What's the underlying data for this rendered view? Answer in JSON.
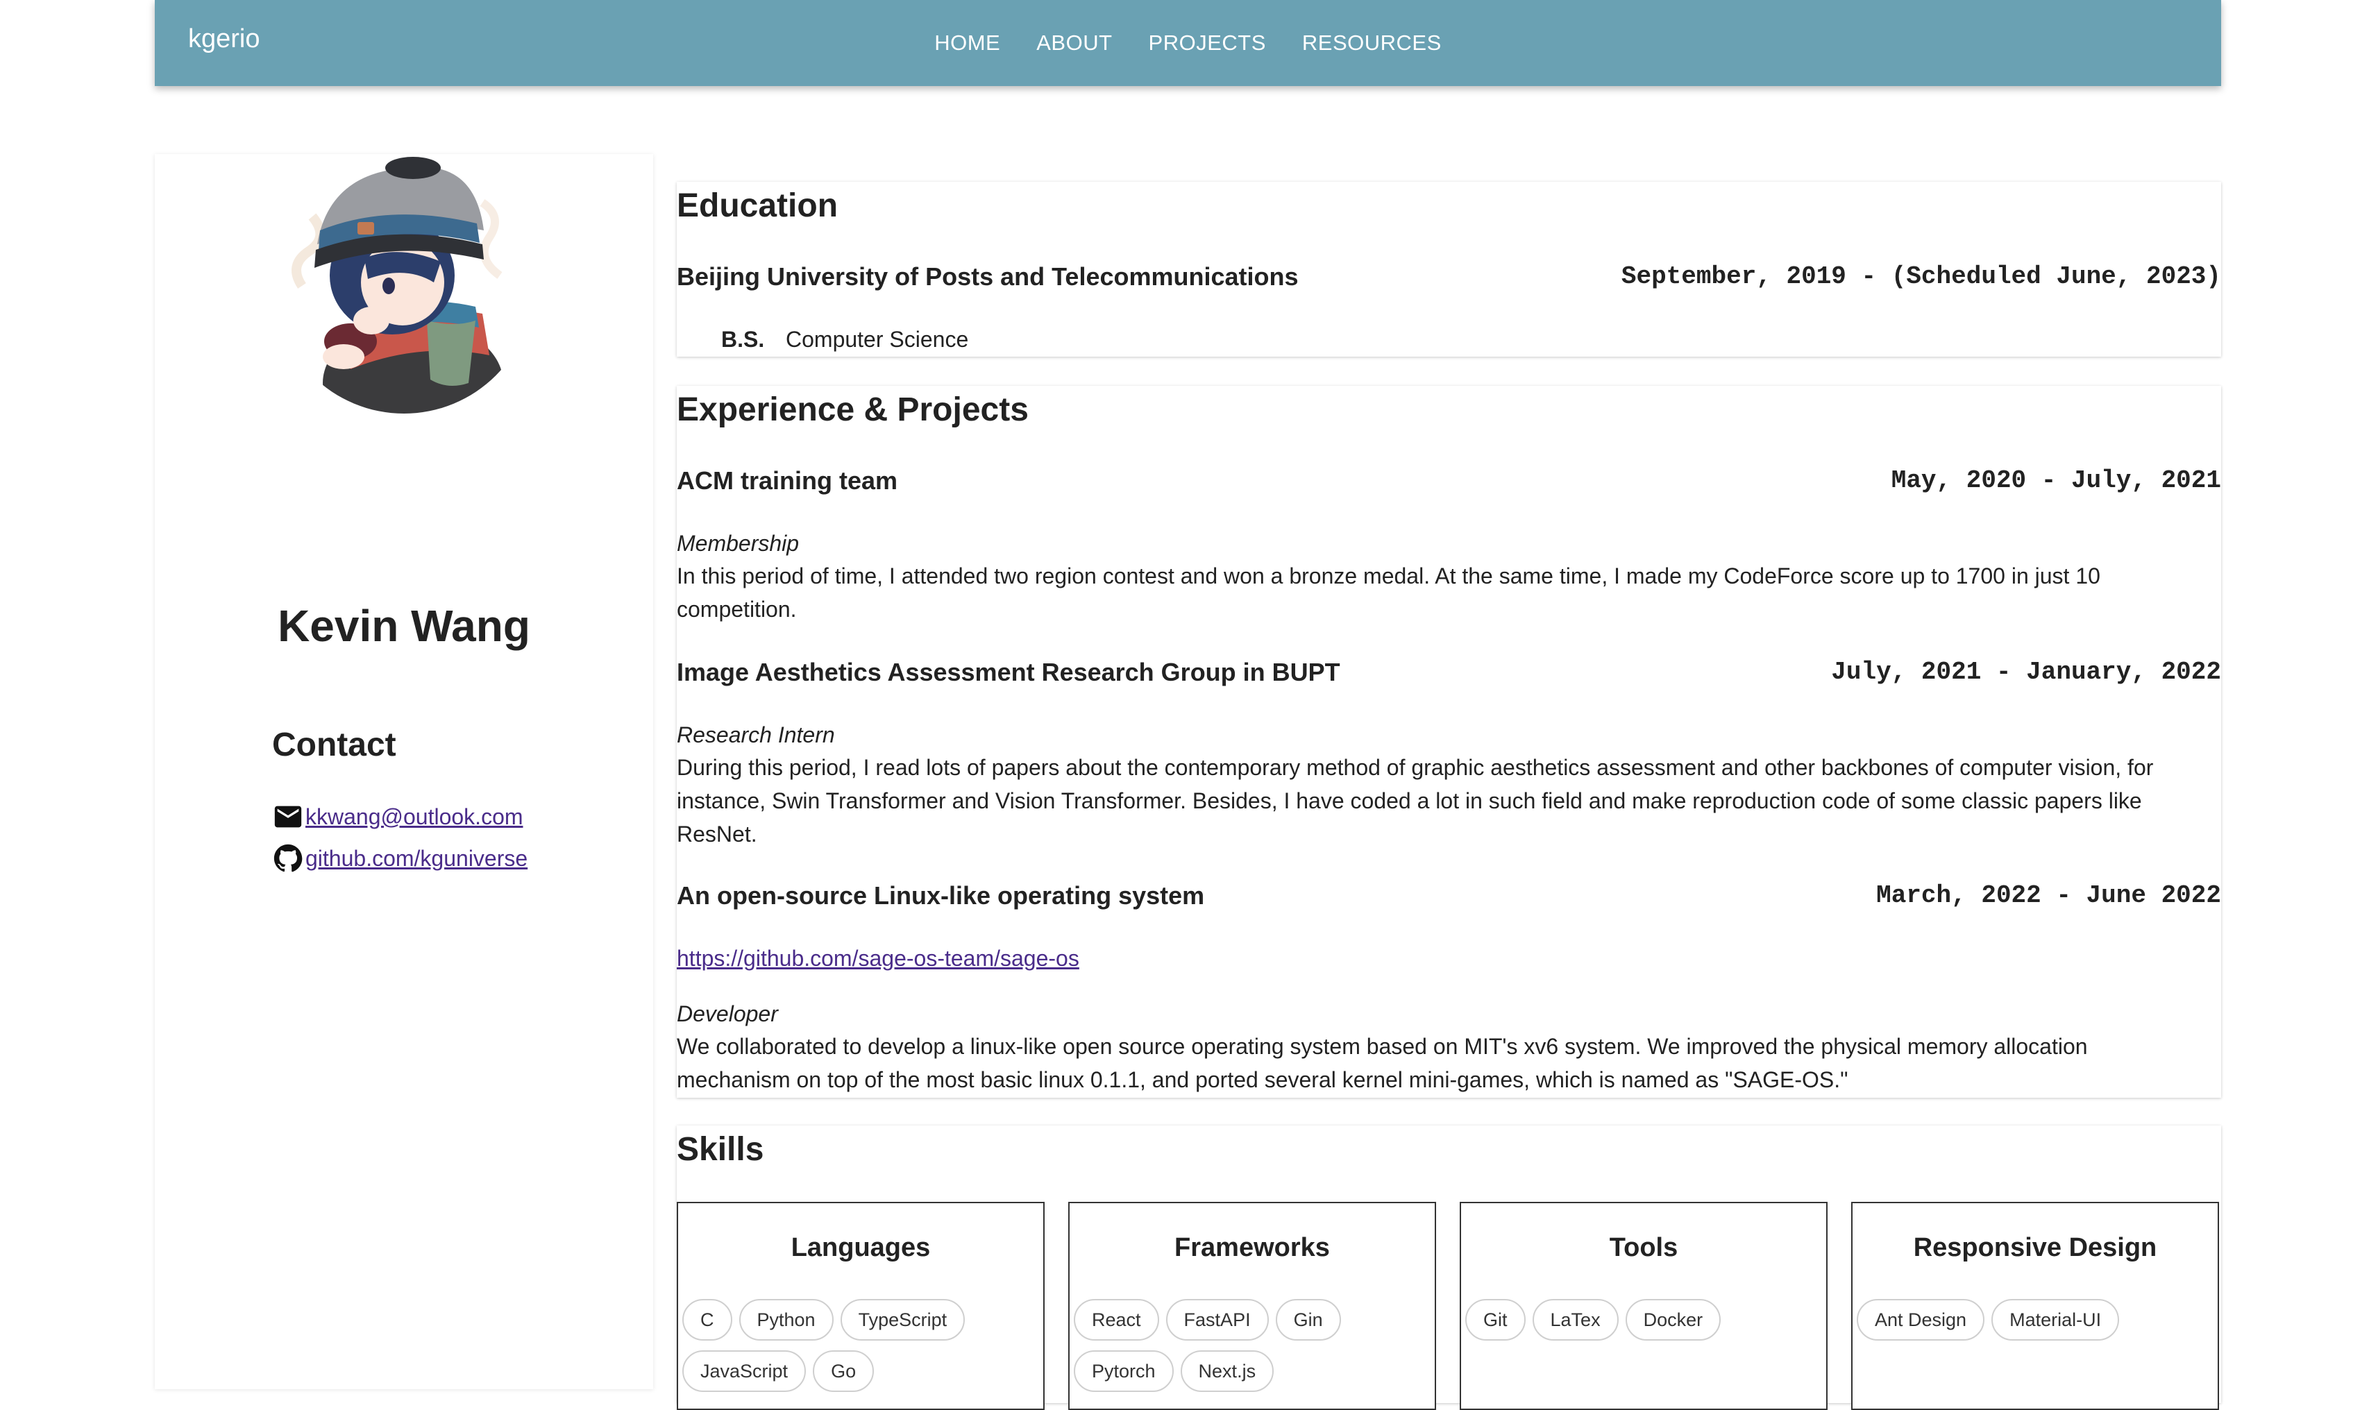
{
  "navbar": {
    "brand": "kgerio",
    "links": [
      "HOME",
      "ABOUT",
      "PROJECTS",
      "RESOURCES"
    ]
  },
  "profile": {
    "name": "Kevin Wang",
    "contact_title": "Contact",
    "email": "kkwang@outlook.com",
    "github": "github.com/kguniverse"
  },
  "education": {
    "title": "Education",
    "school": "Beijing University of Posts and Telecommunications",
    "dates": "September, 2019 - (Scheduled June, 2023)",
    "degree": "B.S.",
    "major": "Computer Science"
  },
  "experience": {
    "title": "Experience & Projects",
    "entries": [
      {
        "title": "ACM training team",
        "dates": "May, 2020 - July, 2021",
        "role": "Membership",
        "description": "In this period of time, I attended two region contest and won a bronze medal. At the same time, I made my CodeForce score up to 1700 in just 10 competition."
      },
      {
        "title": "Image Aesthetics Assessment Research Group in BUPT",
        "dates": "July, 2021 - January, 2022",
        "role": "Research Intern",
        "description": "During this period, I read lots of papers about the contemporary method of graphic aesthetics assessment and other backbones of computer vision, for instance, Swin Transformer and Vision Transformer. Besides, I have coded a lot in such field and make reproduction code of some classic papers like ResNet."
      },
      {
        "title": "An open-source Linux-like operating system",
        "dates": "March, 2022 - June 2022",
        "link": "https://github.com/sage-os-team/sage-os",
        "role": "Developer",
        "description": "We collaborated to develop a linux-like open source operating system based on MIT's xv6 system. We improved the physical memory allocation mechanism on top of the most basic linux 0.1.1, and ported several kernel mini-games, which is named as \"SAGE-OS.\""
      }
    ]
  },
  "skills": {
    "title": "Skills",
    "groups": [
      {
        "title": "Languages",
        "items": [
          "C",
          "Python",
          "TypeScript",
          "JavaScript",
          "Go"
        ]
      },
      {
        "title": "Frameworks",
        "items": [
          "React",
          "FastAPI",
          "Gin",
          "Pytorch",
          "Next.js"
        ]
      },
      {
        "title": "Tools",
        "items": [
          "Git",
          "LaTex",
          "Docker"
        ]
      },
      {
        "title": "Responsive Design",
        "items": [
          "Ant Design",
          "Material-UI"
        ]
      }
    ]
  },
  "colors": {
    "navbar": "#6aa1b3",
    "link": "#4a2c8a"
  }
}
